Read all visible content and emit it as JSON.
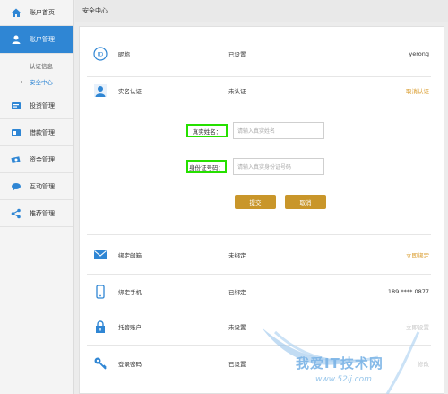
{
  "sidebar": {
    "items": [
      {
        "label": "账户首页",
        "icon": "home-icon"
      },
      {
        "label": "账户管理",
        "icon": "user-icon"
      },
      {
        "label": "投资管理",
        "icon": "invest-icon"
      },
      {
        "label": "借款管理",
        "icon": "loan-icon"
      },
      {
        "label": "资金管理",
        "icon": "money-icon"
      },
      {
        "label": "互动管理",
        "icon": "chat-icon"
      },
      {
        "label": "推荐管理",
        "icon": "share-icon"
      }
    ],
    "subitems": [
      {
        "label": "认证信息"
      },
      {
        "label": "安全中心"
      }
    ]
  },
  "header": {
    "title": "安全中心"
  },
  "rows": {
    "nickname": {
      "label": "昵称",
      "status": "已设置",
      "value": "yerong"
    },
    "realname": {
      "label": "实名认证",
      "status": "未认证",
      "action": "取消认证"
    },
    "email": {
      "label": "绑定邮箱",
      "status": "未绑定",
      "action": "立即绑定"
    },
    "phone": {
      "label": "绑定手机",
      "status": "已绑定",
      "value": "189 **** 0877"
    },
    "escrow": {
      "label": "托管账户",
      "status": "未设置",
      "action": "立即设置"
    },
    "password": {
      "label": "登录密码",
      "status": "已设置",
      "action": "修改"
    }
  },
  "form": {
    "name_label": "真实姓名：",
    "name_placeholder": "请输入真实姓名",
    "id_label": "身份证号码：",
    "id_placeholder": "请输入真实身份证号码",
    "submit_label": "提交",
    "cancel_label": "取消"
  },
  "watermark": {
    "title": "我爱IT技术网",
    "url": "www.52ij.com"
  },
  "colors": {
    "accent": "#2f86d4",
    "action": "#d99b2b",
    "button": "#c9962a",
    "highlight": "#26e000"
  }
}
